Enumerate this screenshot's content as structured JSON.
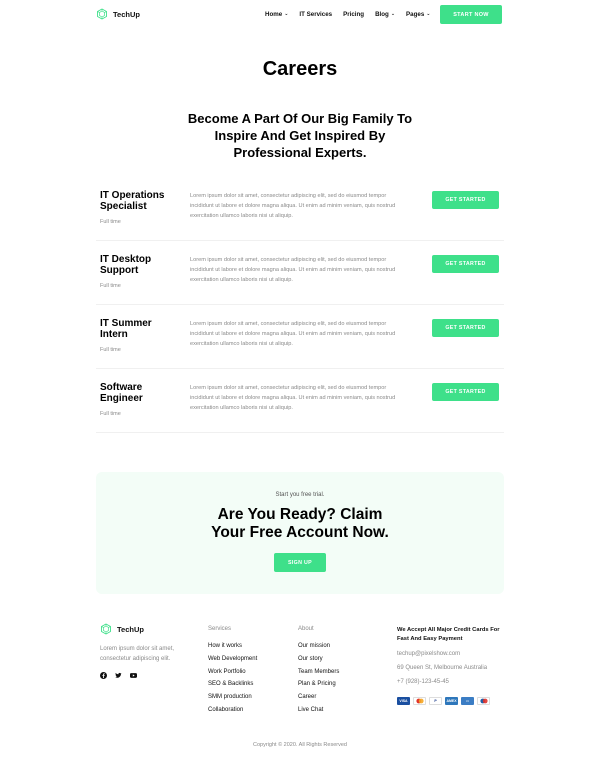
{
  "header": {
    "brand": "TechUp",
    "nav": [
      {
        "label": "Home",
        "dropdown": true
      },
      {
        "label": "IT Services",
        "dropdown": false
      },
      {
        "label": "Pricing",
        "dropdown": false
      },
      {
        "label": "Blog",
        "dropdown": true
      },
      {
        "label": "Pages",
        "dropdown": true
      }
    ],
    "cta_label": "START NOW"
  },
  "page": {
    "title": "Careers",
    "subtitle": "Become A Part Of Our Big Family To Inspire And Get Inspired By Professional Experts."
  },
  "jobs": [
    {
      "title": "IT Operations Specialist",
      "type": "Full time",
      "description": "Lorem ipsum dolor sit amet, consectetur adipiscing elit, sed do eiusmod tempor incididunt ut labore et dolore magna aliqua. Ut enim ad minim veniam, quis nostrud exercitation ullamco laboris nisi ut aliquip.",
      "button": "GET STARTED"
    },
    {
      "title": "IT Desktop Support",
      "type": "Full time",
      "description": "Lorem ipsum dolor sit amet, consectetur adipiscing elit, sed do eiusmod tempor incididunt ut labore et dolore magna aliqua. Ut enim ad minim veniam, quis nostrud exercitation ullamco laboris nisi ut aliquip.",
      "button": "GET STARTED"
    },
    {
      "title": "IT Summer Intern",
      "type": "Full time",
      "description": "Lorem ipsum dolor sit amet, consectetur adipiscing elit, sed do eiusmod tempor incididunt ut labore et dolore magna aliqua. Ut enim ad minim veniam, quis nostrud exercitation ullamco laboris nisi ut aliquip.",
      "button": "GET STARTED"
    },
    {
      "title": "Software Engineer",
      "type": "Full time",
      "description": "Lorem ipsum dolor sit amet, consectetur adipiscing elit, sed do eiusmod tempor incididunt ut labore et dolore magna aliqua. Ut enim ad minim veniam, quis nostrud exercitation ullamco laboris nisi ut aliquip.",
      "button": "GET STARTED"
    }
  ],
  "cta": {
    "small": "Start you free trial.",
    "title": "Are You Ready? Claim Your Free Account Now.",
    "button": "SIGN UP"
  },
  "footer": {
    "brand": "TechUp",
    "blurb": "Lorem ipsum dolor sit amet, consectetur adipiscing elit.",
    "social_icons": [
      "facebook-icon",
      "twitter-icon",
      "youtube-icon"
    ],
    "services": {
      "heading": "Services",
      "items": [
        "How it works",
        "Web Development",
        "Work Portfolio",
        "SEO & Backlinks",
        "SMM production",
        "Collaboration"
      ]
    },
    "about": {
      "heading": "About",
      "items": [
        "Our mission",
        "Our story",
        "Team Members",
        "Plan & Pricing",
        "Career",
        "Live Chat"
      ]
    },
    "payment": {
      "heading": "We Accept All Major Credit Cards For Fast And Easy Payment",
      "email": "techup@pixelshow.com",
      "address": "69 Queen St, Melbourne Australia",
      "phone": "+7 (928)-123-45-45",
      "cards": [
        {
          "name": "VISA",
          "color": "#1a4fa0"
        },
        {
          "name": "MC",
          "color": "#e8a020"
        },
        {
          "name": "PP",
          "color": "#ffffff"
        },
        {
          "name": "AMEX",
          "color": "#2e77bb"
        },
        {
          "name": "CARD",
          "color": "#3b7dc4"
        },
        {
          "name": "MAE",
          "color": "#1d5fa8"
        }
      ]
    },
    "copyright": "Copyright © 2020.  All Rights Reserved"
  },
  "colors": {
    "accent": "#3ee08a",
    "cta_bg": "#f3fdf7",
    "muted": "#8a8a8a"
  }
}
